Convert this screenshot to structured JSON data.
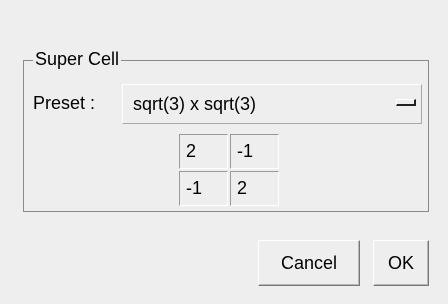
{
  "group": {
    "title": "Super Cell"
  },
  "preset": {
    "label": "Preset :",
    "value": "sqrt(3) x sqrt(3)"
  },
  "matrix": {
    "rows": [
      [
        "2",
        "-1"
      ],
      [
        "-1",
        "2"
      ]
    ]
  },
  "buttons": {
    "cancel": "Cancel",
    "ok": "OK"
  }
}
